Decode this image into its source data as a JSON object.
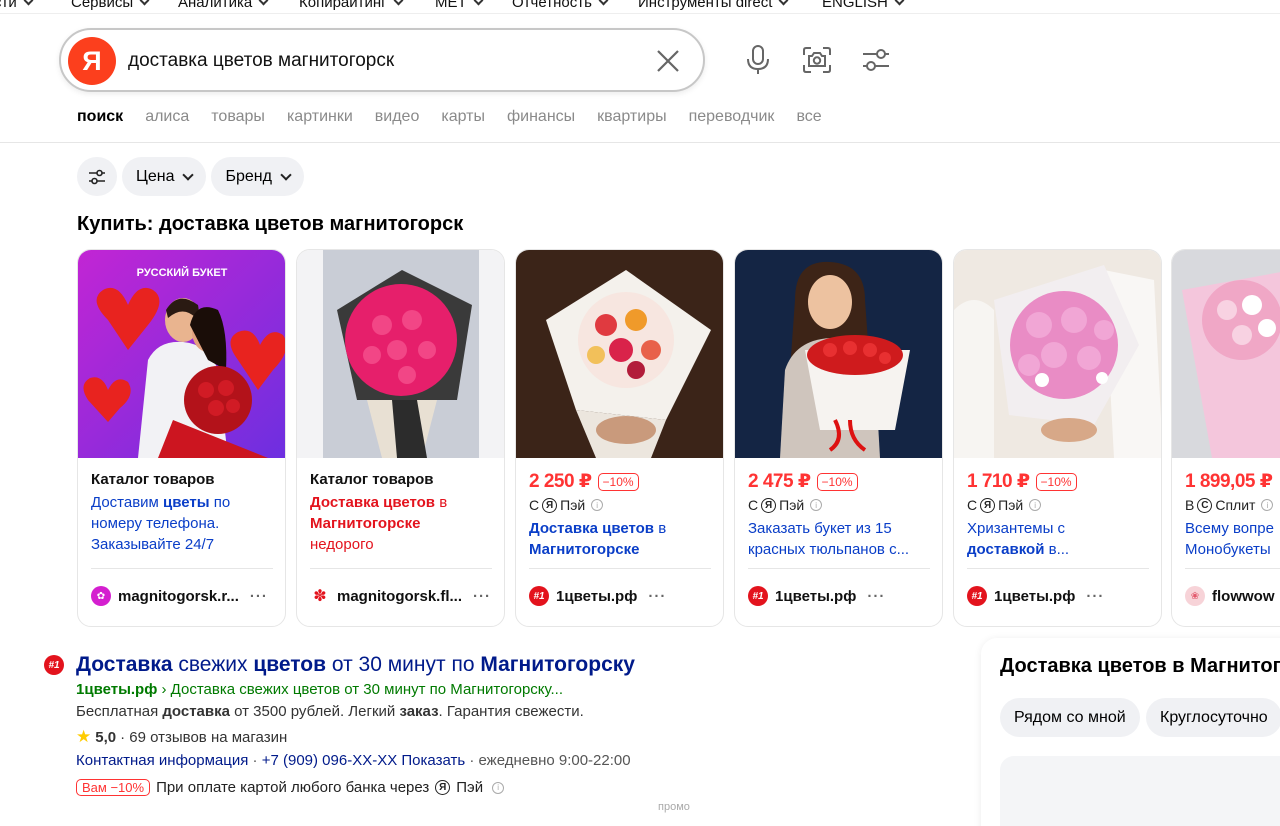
{
  "topnav": [
    "сти",
    "Сервисы",
    "Аналитика",
    "Копирайтинг",
    "MET",
    "Отчетность",
    "Инструменты direct",
    "ENGLISH"
  ],
  "search": {
    "query": "доставка цветов магнитогорск",
    "logo": "Я"
  },
  "tabs": [
    "поиск",
    "алиса",
    "товары",
    "картинки",
    "видео",
    "карты",
    "финансы",
    "квартиры",
    "переводчик",
    "все"
  ],
  "filters": {
    "price": "Цена",
    "brand": "Бренд"
  },
  "section_title": "Купить: доставка цветов магнитогорск",
  "cards": [
    {
      "img_label": "РУССКИЙ БУКЕТ",
      "title": "Каталог товаров",
      "desc_a": "Доставим ",
      "desc_b": "цветы",
      "desc_c": " по номеру телефона. Заказывайте 24/7",
      "shop": "magnitogorsk.r..."
    },
    {
      "title": "Каталог товаров",
      "desc_a": "Доставка цветов",
      "desc_b": " в ",
      "desc_c": "Магнитогорске",
      "desc_d": "недорого",
      "shop": "magnitogorsk.fl..."
    },
    {
      "price": "2 250 ₽",
      "discount": "−10%",
      "pay": "Пэй",
      "desc_a": "Доставка цветов",
      "desc_b": " в ",
      "desc_c": "Магнитогорске",
      "shop": "1цветы.рф"
    },
    {
      "price": "2 475 ₽",
      "discount": "−10%",
      "pay": "Пэй",
      "desc": "Заказать букет из 15 красных тюльпанов с...",
      "shop": "1цветы.рф"
    },
    {
      "price": "1 710 ₽",
      "discount": "−10%",
      "pay": "Пэй",
      "desc_a": "Хризантемы с ",
      "desc_b": "доставкой",
      "desc_c": " в...",
      "shop": "1цветы.рф"
    },
    {
      "price": "1 899,05 ₽",
      "pay": "Сплит",
      "desc": "Всему вопре Монобукеты",
      "shop": "flowwow"
    }
  ],
  "pay_prefix": "С",
  "split_prefix": "В",
  "ad": {
    "fav": "#1",
    "title_1": "Доставка",
    "title_2": " свежих ",
    "title_3": "цветов",
    "title_4": " от 30 минут по ",
    "title_5": "Магнитогорску",
    "domain": "1цветы.рф",
    "path": " › Доставка свежих цветов от 30 минут по Магнитогорску...",
    "text_1": "Бесплатная ",
    "text_2": "доставка",
    "text_3": " от 3500 рублей. Легкий ",
    "text_4": "заказ",
    "text_5": ". Гарантия свежести.",
    "rating": "5,0",
    "reviews": "· 69 отзывов на магазин",
    "contact": "Контактная информация",
    "phone": "+7 (909) 096-XX-XX Показать",
    "hours": "ежедневно 9:00-22:00",
    "promo_badge": "Вам −10%",
    "promo_text": "При оплате картой любого банка через",
    "promo_pay": "Пэй"
  },
  "promo_label": "промо",
  "right_panel": {
    "title": "Доставка цветов в Магнитого",
    "chip_1": "Рядом со мной",
    "chip_2": "Круглосуточно"
  },
  "colors": {
    "brand": "#fc3f1d",
    "price": "#ff3333",
    "link": "#0a3ec8",
    "url": "#007a00"
  }
}
